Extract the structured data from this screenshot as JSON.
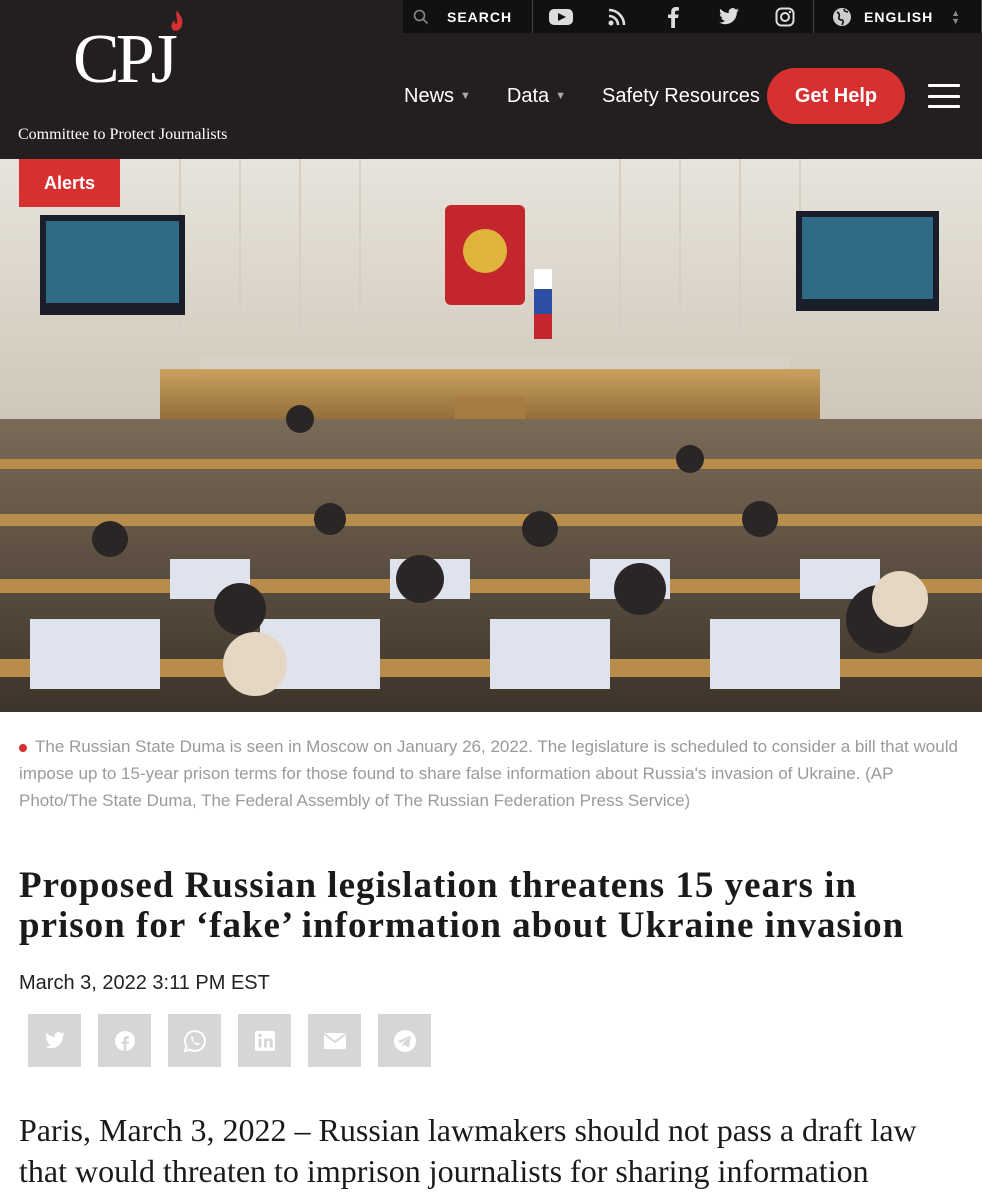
{
  "topbar": {
    "search_label": "SEARCH",
    "language_label": "ENGLISH",
    "social_icons": [
      "youtube-icon",
      "rss-icon",
      "facebook-icon",
      "twitter-icon",
      "instagram-icon"
    ]
  },
  "logo": {
    "wordmark": "CPJ",
    "tagline": "Committee to Protect Journalists"
  },
  "nav": {
    "items": [
      {
        "label": "News"
      },
      {
        "label": "Data"
      },
      {
        "label": "Safety Resources"
      }
    ],
    "cta": "Get Help"
  },
  "hero": {
    "badge": "Alerts"
  },
  "caption": "The Russian State Duma is seen in Moscow on January 26, 2022. The legislature is scheduled to consider a bill that would impose up to 15-year prison terms for those found to share false information about Russia's invasion of Ukraine. (AP Photo/The State Duma, The Federal Assembly of The Russian Federation Press Service)",
  "article": {
    "title": "Proposed Russian legislation threatens 15 years in prison for ‘fake’ information about Ukraine invasion",
    "date": "March 3, 2022 3:11 PM EST",
    "share_icons": [
      "twitter-icon",
      "facebook-icon",
      "whatsapp-icon",
      "linkedin-icon",
      "email-icon",
      "telegram-icon"
    ],
    "lede": "Paris, March 3, 2022 – Russian lawmakers should not pass a draft law that would threaten to imprison journalists for sharing information"
  },
  "colors": {
    "header_bg": "#231f20",
    "accent_red": "#d63031",
    "caption_gray": "#9a9a9a",
    "share_bg": "#d6d6d6"
  }
}
